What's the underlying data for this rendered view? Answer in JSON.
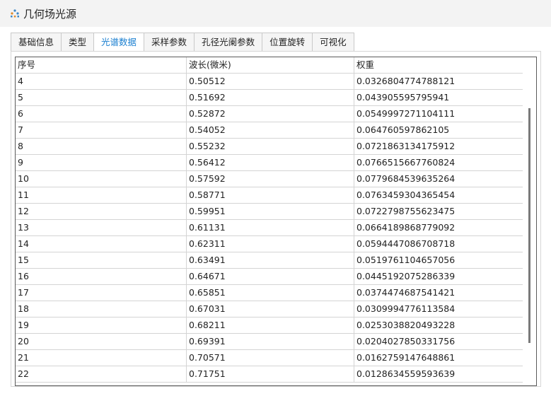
{
  "window": {
    "title": "几何场光源"
  },
  "tabs": [
    {
      "label": "基础信息",
      "active": false
    },
    {
      "label": "类型",
      "active": false
    },
    {
      "label": "光谱数据",
      "active": true
    },
    {
      "label": "采样参数",
      "active": false
    },
    {
      "label": "孔径光阑参数",
      "active": false
    },
    {
      "label": "位置旋转",
      "active": false
    },
    {
      "label": "可视化",
      "active": false
    }
  ],
  "table": {
    "headers": [
      "序号",
      "波长(微米)",
      "权重"
    ],
    "rows": [
      [
        "4",
        "0.50512",
        "0.0326804774788121"
      ],
      [
        "5",
        "0.51692",
        "0.043905595795941"
      ],
      [
        "6",
        "0.52872",
        "0.0549997271104111"
      ],
      [
        "7",
        "0.54052",
        "0.064760597862105"
      ],
      [
        "8",
        "0.55232",
        "0.0721863134175912"
      ],
      [
        "9",
        "0.56412",
        "0.0766515667760824"
      ],
      [
        "10",
        "0.57592",
        "0.0779684539635264"
      ],
      [
        "11",
        "0.58771",
        "0.0763459304365454"
      ],
      [
        "12",
        "0.59951",
        "0.0722798755623475"
      ],
      [
        "13",
        "0.61131",
        "0.0664189868779092"
      ],
      [
        "14",
        "0.62311",
        "0.0594447086708718"
      ],
      [
        "15",
        "0.63491",
        "0.0519761104657056"
      ],
      [
        "16",
        "0.64671",
        "0.0445192075286339"
      ],
      [
        "17",
        "0.65851",
        "0.0374474687541421"
      ],
      [
        "18",
        "0.67031",
        "0.0309994776113584"
      ],
      [
        "19",
        "0.68211",
        "0.0253038820493228"
      ],
      [
        "20",
        "0.69391",
        "0.0204027850331756"
      ],
      [
        "21",
        "0.70571",
        "0.0162759147648861"
      ],
      [
        "22",
        "0.71751",
        "0.0128634559593639"
      ]
    ]
  },
  "colors": {
    "active_tab_text": "#1a7fd0",
    "grid_line": "#d4d4d4",
    "frame": "#5a5a5a"
  },
  "icons": {
    "app": "light-source-icon"
  }
}
